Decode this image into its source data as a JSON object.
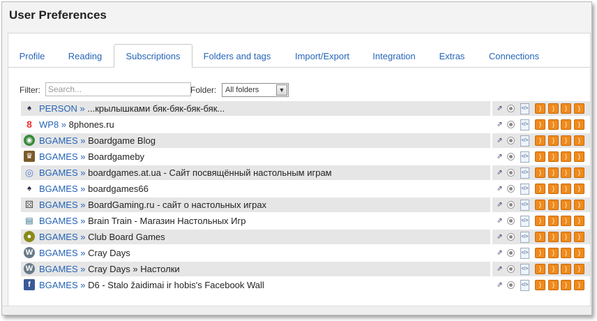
{
  "window": {
    "title": "User Preferences"
  },
  "tabs": [
    {
      "label": "Profile",
      "active": false
    },
    {
      "label": "Reading",
      "active": false
    },
    {
      "label": "Subscriptions",
      "active": true
    },
    {
      "label": "Folders and tags",
      "active": false
    },
    {
      "label": "Import/Export",
      "active": false
    },
    {
      "label": "Integration",
      "active": false
    },
    {
      "label": "Extras",
      "active": false
    },
    {
      "label": "Connections",
      "active": false
    }
  ],
  "filter": {
    "label": "Filter:",
    "placeholder": "Search...",
    "folder_label": "Folder:",
    "folder_selected": "All folders"
  },
  "subscriptions": [
    {
      "group": "PERSON",
      "sep": "»",
      "feed": "...крылышками бяк-бяк-бяк-бяк...",
      "icon": "person-icon"
    },
    {
      "group": "WP8",
      "sep": "»",
      "feed": "8phones.ru",
      "icon": "wp8-logo-icon"
    },
    {
      "group": "BGAMES",
      "sep": "»",
      "feed": "Boardgame Blog",
      "icon": "globe-icon"
    },
    {
      "group": "BGAMES",
      "sep": "»",
      "feed": "Boardgameby",
      "icon": "meeple-icon"
    },
    {
      "group": "BGAMES",
      "sep": "»",
      "feed": "boardgames.at.ua - Сайт посвящённый настольным играм",
      "icon": "ucoz-icon"
    },
    {
      "group": "BGAMES",
      "sep": "»",
      "feed": "boardgames66",
      "icon": "person-icon"
    },
    {
      "group": "BGAMES",
      "sep": "»",
      "feed": "BoardGaming.ru - сайт о настольных играх",
      "icon": "dice-icon"
    },
    {
      "group": "BGAMES",
      "sep": "»",
      "feed": "Brain Train - Магазин Настольных Игр",
      "icon": "train-icon"
    },
    {
      "group": "BGAMES",
      "sep": "»",
      "feed": "Club Board Games",
      "icon": "club-icon"
    },
    {
      "group": "BGAMES",
      "sep": "»",
      "feed": "Cray Days",
      "icon": "wordpress-icon"
    },
    {
      "group": "BGAMES",
      "sep": "»",
      "feed": "Cray Days » Настолки",
      "icon": "wordpress-icon"
    },
    {
      "group": "BGAMES",
      "sep": "»",
      "feed": "D6 - Stalo žaidimai ir hobis's Facebook Wall",
      "icon": "facebook-icon"
    }
  ],
  "action_icons": [
    "external-link-icon",
    "radio-icon",
    "xml-file-icon",
    "rss-add-icon",
    "rss-edit-icon",
    "rss-remove-icon",
    "rss-folder-icon"
  ]
}
